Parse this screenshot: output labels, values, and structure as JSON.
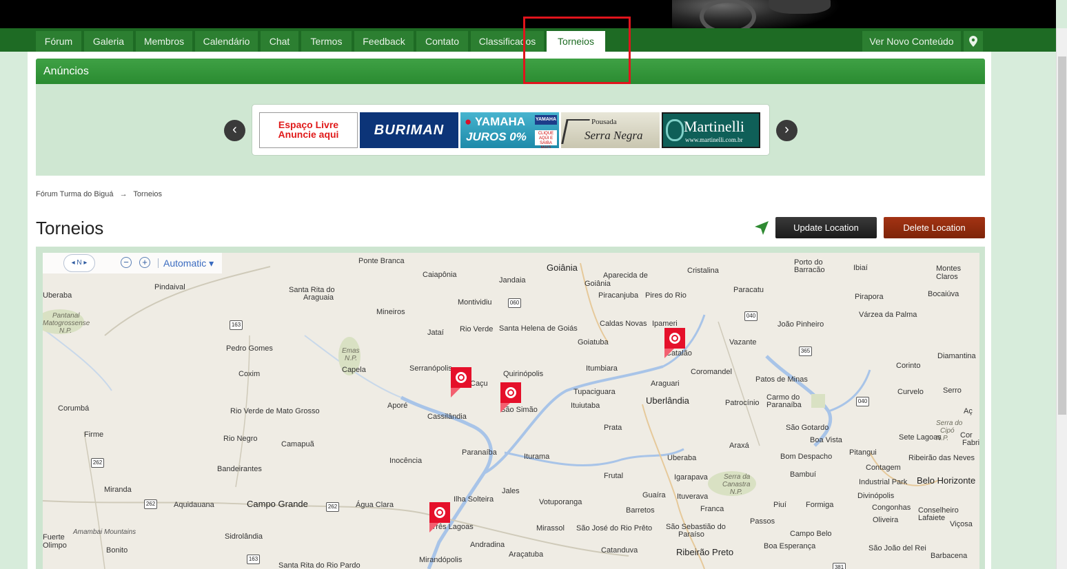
{
  "nav": {
    "items": [
      "Fórum",
      "Galeria",
      "Membros",
      "Calendário",
      "Chat",
      "Termos",
      "Feedback",
      "Contato",
      "Classificados",
      "Torneios"
    ],
    "active": "Torneios",
    "new_content": "Ver Novo Conteúdo"
  },
  "ads": {
    "title": "Anúncios",
    "prev": "‹",
    "next": "›",
    "espaco_line1": "Espaço Livre",
    "espaco_line2": "Anuncie aqui",
    "buriman": "BURIMAN",
    "yamaha_brand": "YAMAHA",
    "yamaha_offer": "JUROS 0%",
    "yamaha_badge": "YAMAHA",
    "yamaha_cta": "CLIQUE AQUI E SAIBA MAIS",
    "pousada_line1": "Pousada",
    "pousada_line2": "Serra Negra",
    "martinelli_name": "Martinelli",
    "martinelli_url": "www.martinelli.com.br"
  },
  "breadcrumb": {
    "home": "Fórum Turma do Biguá",
    "separator": "→",
    "current": "Torneios"
  },
  "page": {
    "title": "Torneios",
    "update_button": "Update Location",
    "delete_button": "Delete Location"
  },
  "map": {
    "compass": "N",
    "zoom_out": "−",
    "zoom_in": "+",
    "mode": "Automatic ▾",
    "labels": {
      "ponte_branca": "Ponte Branca",
      "goiania": "Goiânia",
      "aparecida": "Aparecida de",
      "goiania2": "Goiânia",
      "cristalina": "Cristalina",
      "porto_do": "Porto do",
      "barracao": "Barracão",
      "ibiai": "Ibiaí",
      "montes": "Montes",
      "claros": "Claros",
      "caiaponia": "Caiapônia",
      "jandaia": "Jandaia",
      "pindaival": "Pindaival",
      "santa_rita": "Santa Rita do",
      "araguaia": "Araguaia",
      "uberaba_left": "Uberaba",
      "piracanjuba": "Piracanjuba",
      "pires_do_rio": "Pires do Rio",
      "paracatu": "Paracatu",
      "pirapora": "Pirapora",
      "bocaiuva": "Bocaiúva",
      "montividiu": "Montividiu",
      "mineiros": "Mineiros",
      "varzea": "Várzea da Palma",
      "pantanal": "Pantanal",
      "matogrossense": "Matogrossense",
      "np1": "N.P.",
      "caldas": "Caldas Novas",
      "ipameri": "Ipameri",
      "joao_pinheiro": "João Pinheiro",
      "jatai": "Jataí",
      "rio_verde": "Rio Verde",
      "santa_helena": "Santa Helena de Goiás",
      "goiatuba": "Goiatuba",
      "vazante": "Vazante",
      "pedro_gomes": "Pedro Gomes",
      "emas": "Emas",
      "np2": "N.P.",
      "catalao": "Catalão",
      "diamantina": "Diamantina",
      "capela": "Capela",
      "serranopolis": "Serranópolis",
      "corinto": "Corinto",
      "coxim": "Coxim",
      "cacu": "Caçu",
      "quirinopolis": "Quirinópolis",
      "itumbiara": "Itumbiara",
      "coromandel": "Coromandel",
      "patos": "Patos de Minas",
      "araguari": "Araguari",
      "curvelo": "Curvelo",
      "serro": "Serro",
      "tupaciguara": "Tupaciguara",
      "uberlandia": "Uberlândia",
      "carmo_do": "Carmo do",
      "paranaiba_mg": "Paranaíba",
      "corumba": "Corumbá",
      "apore": "Aporé",
      "sao_simao": "São Simão",
      "ituiutaba": "Ituiutaba",
      "patrocinio": "Patrocínio",
      "cassilandia": "Cassilândia",
      "rio_verde_mt": "Rio Verde de Mato Grosso",
      "firme": "Firme",
      "prata": "Prata",
      "sao_gotardo": "São Gotardo",
      "serra_do": "Serra do",
      "cipo": "Cipó",
      "np3": "N.P.",
      "sete_lagoas": "Sete Lagoas",
      "boa_vista": "Boa Vista",
      "rio_negro": "Rio Negro",
      "camapua": "Camapuã",
      "araxa": "Araxá",
      "paranaiba": "Paranaíba",
      "iturama": "Iturama",
      "uberaba": "Uberaba",
      "bom_despacho": "Bom Despacho",
      "pitangui": "Pitangui",
      "ribeirao_neves": "Ribeirão das Neves",
      "inocencia": "Inocência",
      "contagem": "Contagem",
      "bandeirantes": "Bandeirantes",
      "frutal": "Frutal",
      "igarapava": "Igarapava",
      "serra_da": "Serra da",
      "canastra": "Canastra",
      "np4": "N.P.",
      "bambui": "Bambuí",
      "industrial": "Industrial Park",
      "belo_horizonte": "Belo Horizonte",
      "miranda": "Miranda",
      "jales": "Jales",
      "guaira": "Guaíra",
      "divinopolis": "Divinópolis",
      "ilha_solteira": "Ilha Solteira",
      "votuporanga": "Votuporanga",
      "ituverava": "Ituverava",
      "aquidauana": "Aquidauana",
      "campo_grande": "Campo Grande",
      "agua_clara": "Água Clara",
      "piui": "Piuí",
      "formiga": "Formiga",
      "congonhas": "Congonhas",
      "conselheiro": "Conselheiro",
      "lafaiete": "Lafaiete",
      "barretos": "Barretos",
      "franca": "Franca",
      "oliveira": "Oliveira",
      "amambai": "Amambai Mountains",
      "tres_lagoas": "Três Lagoas",
      "mirassol": "Mirassol",
      "sao_jose": "São José do Rio Prêto",
      "sao_sebastiao": "São Sebastião do",
      "paraiso": "Paraíso",
      "passos": "Passos",
      "vicosa": "Viçosa",
      "fuerte": "Fuerte",
      "olimpo": "Olimpo",
      "sidrolandia": "Sidrolândia",
      "andradina": "Andradina",
      "campo_belo": "Campo Belo",
      "bonito": "Bonito",
      "aracatuba": "Araçatuba",
      "catanduva": "Catanduva",
      "ribeirao_preto": "Ribeirão Preto",
      "boa_esperanca": "Boa Esperança",
      "sao_joao": "São João del Rei",
      "barbacena": "Barbacena",
      "mirandopolis": "Mirandópolis",
      "santa_rita_pardo": "Santa Rita do Rio Pardo",
      "fabric": "Fabric",
      "aci": "Aç",
      "cor": "Cor"
    },
    "shields": [
      "060",
      "163",
      "040",
      "365",
      "040",
      "262",
      "262",
      "262",
      "163",
      "381"
    ]
  },
  "colors": {
    "nav_bg": "#1e6b24",
    "nav_item": "#2c7f31",
    "ads_header": "#3fa145",
    "highlight": "#e0141c",
    "pin": "#e5102a",
    "delete": "#a33314"
  }
}
